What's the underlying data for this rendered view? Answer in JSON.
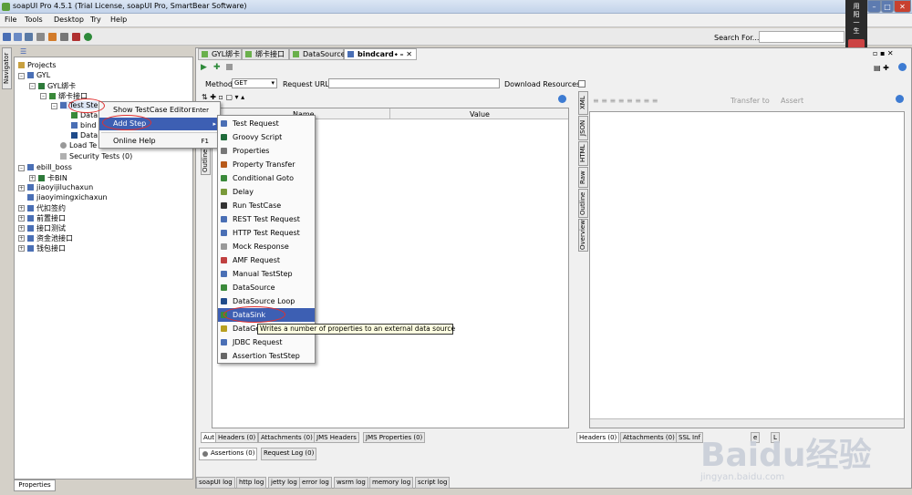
{
  "window": {
    "title": "soapUI Pro 4.5.1 (Trial License, soapUI Pro, SmartBear Software)"
  },
  "menu": [
    "File",
    "Tools",
    "Desktop",
    "Try",
    "Help"
  ],
  "toolbar": {
    "search_label": "Search For..."
  },
  "brand_text": "用 阳 一 生",
  "navigator": {
    "tab_label": "Navigator",
    "properties_tab": "Properties"
  },
  "tree": {
    "projects": "Projects",
    "gyl": "GYL",
    "gyl_card": "GYL绑卡",
    "bind_iface": "绑卡接口",
    "test_steps": "Test Ste",
    "step_data": "Data",
    "step_bind": "bind",
    "step_data2": "Data",
    "load_tests": "Load Te",
    "security_tests": "Security Tests (0)",
    "ebill": "ebill_boss",
    "card_bin": "卡BIN",
    "jiaoyi1": "jiaoyijiluchaxun",
    "jiaoyi2": "jiaoyimingxichaxun",
    "daikou": "代扣签约",
    "qianzhi": "前置接口",
    "jiekou": "接口测试",
    "zijin": "资金池接口",
    "qianbao": "钱包接口"
  },
  "editor_tabs": [
    "GYL绑卡",
    "绑卡接口",
    "DataSource",
    "bindcard"
  ],
  "request": {
    "method_label": "Method",
    "method_value": "GET",
    "url_label": "Request URL:",
    "url_value": "",
    "download_label": "Download Resources",
    "col_name": "Name",
    "col_value": "Value"
  },
  "context_menu": {
    "items": [
      {
        "label": "Show TestCase Editor",
        "key": "Enter"
      },
      {
        "label": "Add Step",
        "key": ""
      },
      {
        "label": "Online Help",
        "key": "F1"
      }
    ]
  },
  "add_step_menu": [
    {
      "label": "Test Request",
      "color": "#4a6fb5"
    },
    {
      "label": "Groovy Script",
      "color": "#1f6b3a"
    },
    {
      "label": "Properties",
      "color": "#777777"
    },
    {
      "label": "Property Transfer",
      "color": "#b85a1a"
    },
    {
      "label": "Conditional Goto",
      "color": "#3a8a3a"
    },
    {
      "label": "Delay",
      "color": "#7a9a3a"
    },
    {
      "label": "Run TestCase",
      "color": "#333333"
    },
    {
      "label": "REST Test Request",
      "color": "#4a6fb5"
    },
    {
      "label": "HTTP Test Request",
      "color": "#4a6fb5"
    },
    {
      "label": "Mock Response",
      "color": "#999999"
    },
    {
      "label": "AMF Request",
      "color": "#c04040"
    },
    {
      "label": "Manual TestStep",
      "color": "#4a6fb5"
    },
    {
      "label": "DataSource",
      "color": "#3a8a3a"
    },
    {
      "label": "DataSource Loop",
      "color": "#1f4b8a"
    },
    {
      "label": "DataSink",
      "color": "#3a8a3a"
    },
    {
      "label": "DataGe",
      "color": "#b8a020"
    },
    {
      "label": "JDBC Request",
      "color": "#4a6fb5"
    },
    {
      "label": "Assertion TestStep",
      "color": "#666666"
    }
  ],
  "tooltip": "Writes a number of properties to an external data source",
  "request_bottom_tabs": [
    "Aut",
    "Headers (0)",
    "Attachments (0)",
    "JMS Headers",
    "JMS Properties (0)"
  ],
  "assertion_tabs": [
    "Assertions (0)",
    "Request Log (0)"
  ],
  "response_toolbar": {
    "transfer": "Transfer to",
    "assert": "Assert"
  },
  "response_side_tabs": [
    "XML",
    "JSON",
    "HTML",
    "Raw",
    "Outline",
    "Overview"
  ],
  "request_side_tab": "Outline",
  "response_bottom_tabs": [
    "Headers (0)",
    "Attachments (0)",
    "SSL Inf",
    "e",
    "L"
  ],
  "log_tabs": [
    "soapUI log",
    "http log",
    "jetty log",
    "error log",
    "wsrm log",
    "memory log",
    "script log"
  ],
  "watermark": "Baidu经验",
  "watermark_url": "jingyan.baidu.com"
}
